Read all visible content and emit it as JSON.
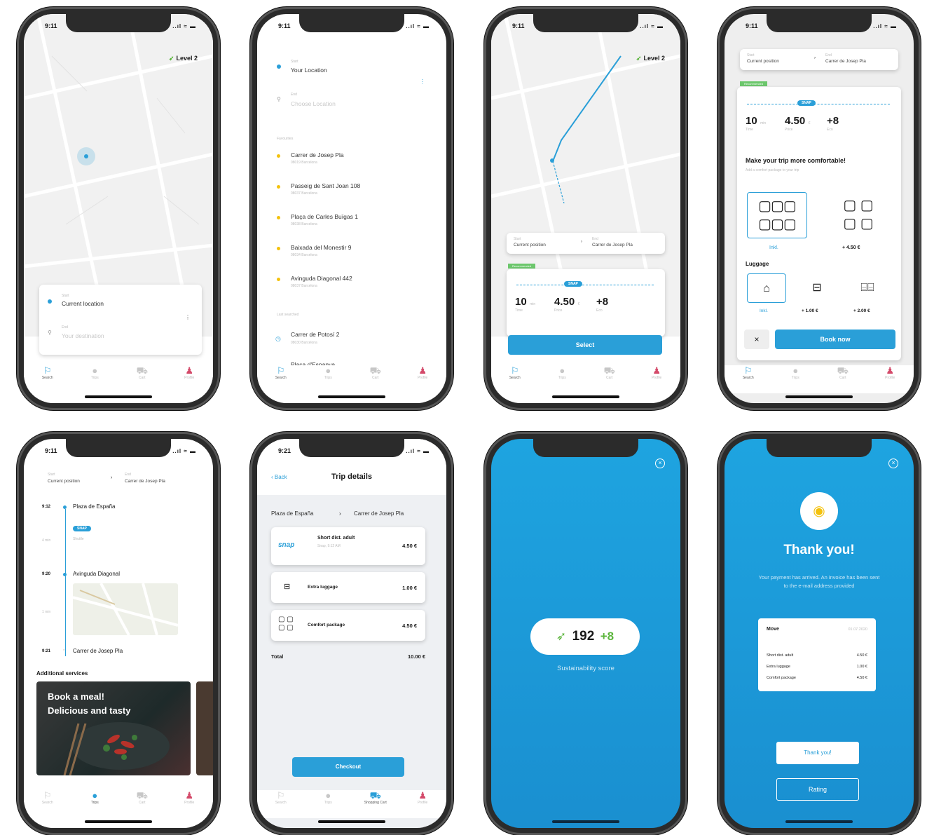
{
  "status_time": "9:11",
  "status_time_alt": "9:21",
  "signal": "..ıl ≈ ▬",
  "level_label": "Level 2",
  "tabs": [
    "Search",
    "Trips",
    "Cart",
    "Profile"
  ],
  "p1": {
    "from_small": "Start",
    "from": "Current location",
    "to_small": "End",
    "to": "Your destination"
  },
  "p2": {
    "from_small": "Start",
    "from": "Your Location",
    "to_small": "End",
    "to": "Choose Location",
    "section_small": "Favourites",
    "items": [
      {
        "name": "Carrer de Josep Pla",
        "sub": "08019 Barcelona"
      },
      {
        "name": "Passeig de Sant Joan 108",
        "sub": "08037 Barcelona"
      },
      {
        "name": "Plaça de Carles Buïgas 1",
        "sub": "08038 Barcelona"
      },
      {
        "name": "Baixada del Monestir 9",
        "sub": "08034 Barcelona"
      },
      {
        "name": "Avinguda Diagonal 442",
        "sub": "08037 Barcelona"
      }
    ],
    "section2_small": "Last searched",
    "items2": [
      {
        "name": "Carrer de Potosí 2",
        "sub": "08030 Barcelona"
      },
      {
        "name": "Plaça d'Espanya",
        "sub": ""
      }
    ]
  },
  "route": {
    "from_small": "Start",
    "from": "Current position",
    "to_small": "End",
    "to": "Carrer de Josep Pla",
    "recommended": "Recommended",
    "badge": "SNAP",
    "stats": [
      {
        "v": "10",
        "u": "min",
        "s": "Time"
      },
      {
        "v": "4.50",
        "u": "€",
        "s": "Price"
      },
      {
        "v": "+8",
        "u": "",
        "s": "Eco"
      }
    ],
    "select": "Select"
  },
  "p4": {
    "title": "Make your trip more comfortable!",
    "subtitle": "Add a comfort package to your trip",
    "seat_opts": [
      {
        "label": "Inkl."
      },
      {
        "label": "+ 4.50 €"
      }
    ],
    "luggage": "Luggage",
    "lug_opts": [
      {
        "label": "Inkl."
      },
      {
        "label": "+ 1.00 €"
      },
      {
        "label": "+ 2.00 €"
      }
    ],
    "close": "×",
    "book": "Book now"
  },
  "p5": {
    "from_small": "Start",
    "from": "Current position",
    "to_small": "End",
    "to": "Carrer de Josep Pla",
    "stops": [
      {
        "t": "9:12",
        "n": "Plaza de España"
      },
      {
        "t": "9:20",
        "n": "Avinguda Diagonal"
      },
      {
        "t": "9:21",
        "n": "Carrer de Josep Pla"
      }
    ],
    "badge": "SNAP",
    "sub1": "Shuttle",
    "sub2": "4 min",
    "sub3": "1 min",
    "additional": "Additional services",
    "promo_line1": "Book a meal!",
    "promo_line2": "Delicious and tasty"
  },
  "p6": {
    "back": "Back",
    "title": "Trip details",
    "route_from": "Plaza de España",
    "route_to": "Carrer de Josep Pla",
    "items": [
      {
        "name": "Short dist. adult",
        "price": "4.50 €",
        "sub": "Snap, 9:12 AM"
      },
      {
        "name": "Extra luggage",
        "price": "1.00 €",
        "sub": ""
      },
      {
        "name": "Comfort package",
        "price": "4.50 €",
        "sub": ""
      }
    ],
    "snap_logo": "snap",
    "total_label": "Total",
    "total": "10.00 €",
    "checkout": "Checkout",
    "cart_tab": "Shopping Cart"
  },
  "p7": {
    "score": "192",
    "delta": "+8",
    "caption": "Sustainability score"
  },
  "p8": {
    "title": "Thank you!",
    "message": "Your payment has arrived. An invoice has been sent to the e-mail address provided",
    "receipt_title": "Move",
    "receipt_date": "01.07.2020",
    "rows": [
      {
        "n": "Short dist. adult",
        "p": "4.50 €"
      },
      {
        "n": "Extra luggage",
        "p": "1.00 €"
      },
      {
        "n": "Comfort package",
        "p": "4.50 €"
      }
    ],
    "thank_btn": "Thank you!",
    "rating_btn": "Rating"
  },
  "colors": {
    "primary": "#2a9fd8",
    "eco": "#5bb53c",
    "accent": "#f4c20d"
  }
}
